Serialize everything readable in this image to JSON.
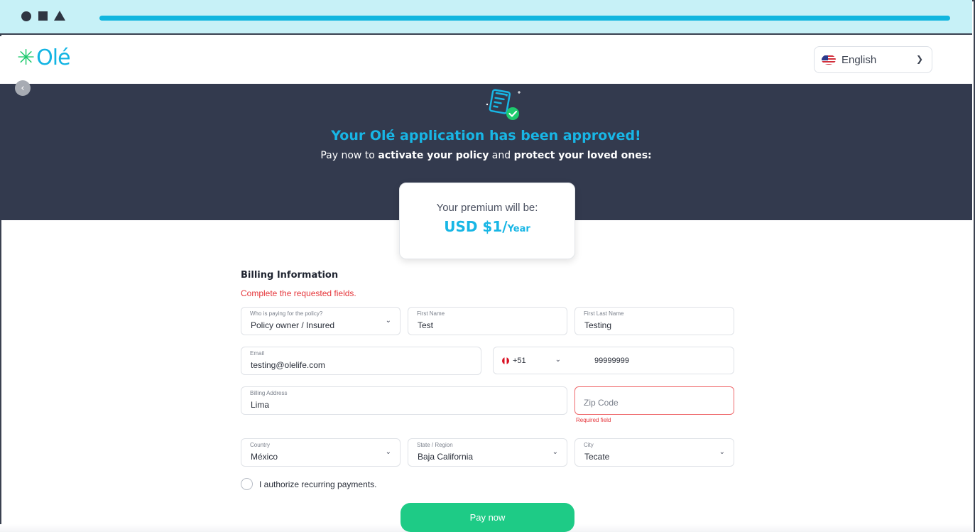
{
  "header": {
    "logo_text": "Olé",
    "language": {
      "selected": "English"
    }
  },
  "banner": {
    "title": "Your Olé application has been approved!",
    "subtitle_prefix": "Pay now to ",
    "subtitle_bold1": "activate your policy",
    "subtitle_mid": " and ",
    "subtitle_bold2": "protect your loved ones:"
  },
  "premium": {
    "label": "Your premium will be:",
    "amount": "USD $1/",
    "period": "Year"
  },
  "billing": {
    "title": "Billing Information",
    "error": "Complete the requested fields.",
    "payer": {
      "label": "Who is paying for the policy?",
      "value": "Policy owner / Insured"
    },
    "first_name": {
      "label": "First Name",
      "value": "Test"
    },
    "last_name": {
      "label": "First Last Name",
      "value": "Testing"
    },
    "email": {
      "label": "Email",
      "value": "testing@olelife.com"
    },
    "phone": {
      "code": "+51",
      "number": "99999999"
    },
    "address": {
      "label": "Billing Address",
      "value": "Lima"
    },
    "zip": {
      "placeholder": "Zip Code",
      "error": "Required field"
    },
    "country": {
      "label": "Country",
      "value": "México"
    },
    "state": {
      "label": "State / Region",
      "value": "Baja California"
    },
    "city": {
      "label": "City",
      "value": "Tecate"
    },
    "recurring_label": "I authorize recurring payments.",
    "pay_button": "Pay now"
  },
  "colors": {
    "brand_blue": "#18b6e5",
    "brand_green": "#1ecb86",
    "banner_bg": "#333a4e",
    "error_red": "#e5363b"
  }
}
